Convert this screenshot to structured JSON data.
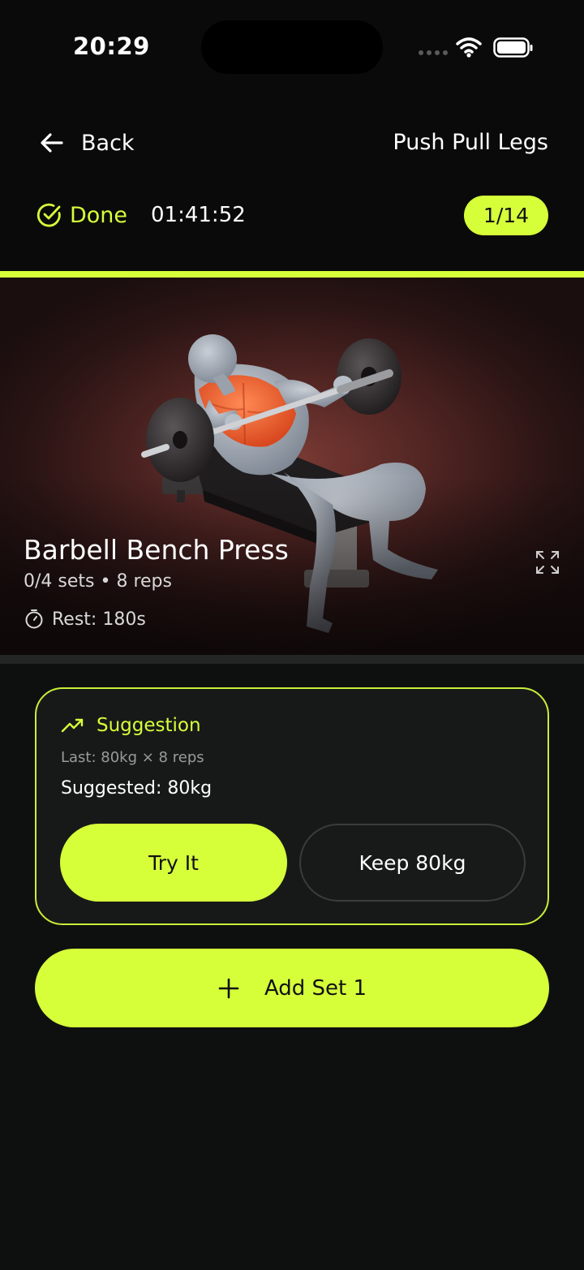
{
  "status_bar": {
    "time": "20:29"
  },
  "header": {
    "back_label": "Back",
    "workout_title": "Push Pull Legs",
    "done_label": "Done",
    "elapsed": "01:41:52",
    "progress": "1/14"
  },
  "exercise": {
    "name": "Barbell Bench Press",
    "meta": "0/4 sets • 8 reps",
    "rest": "Rest: 180s"
  },
  "suggestion": {
    "title": "Suggestion",
    "last": "Last: 80kg × 8 reps",
    "suggested": "Suggested: 80kg",
    "try_label": "Try It",
    "keep_label": "Keep 80kg"
  },
  "add_set_label": "Add Set 1",
  "colors": {
    "accent": "#d6ff3a",
    "background": "#0e1010",
    "card": "#171919",
    "muscle_highlight": "#f0622e"
  },
  "icons": [
    "arrow-left-icon",
    "check-circle-icon",
    "expand-icon",
    "stopwatch-icon",
    "trending-up-icon",
    "plus-icon",
    "wifi-icon",
    "battery-icon"
  ]
}
